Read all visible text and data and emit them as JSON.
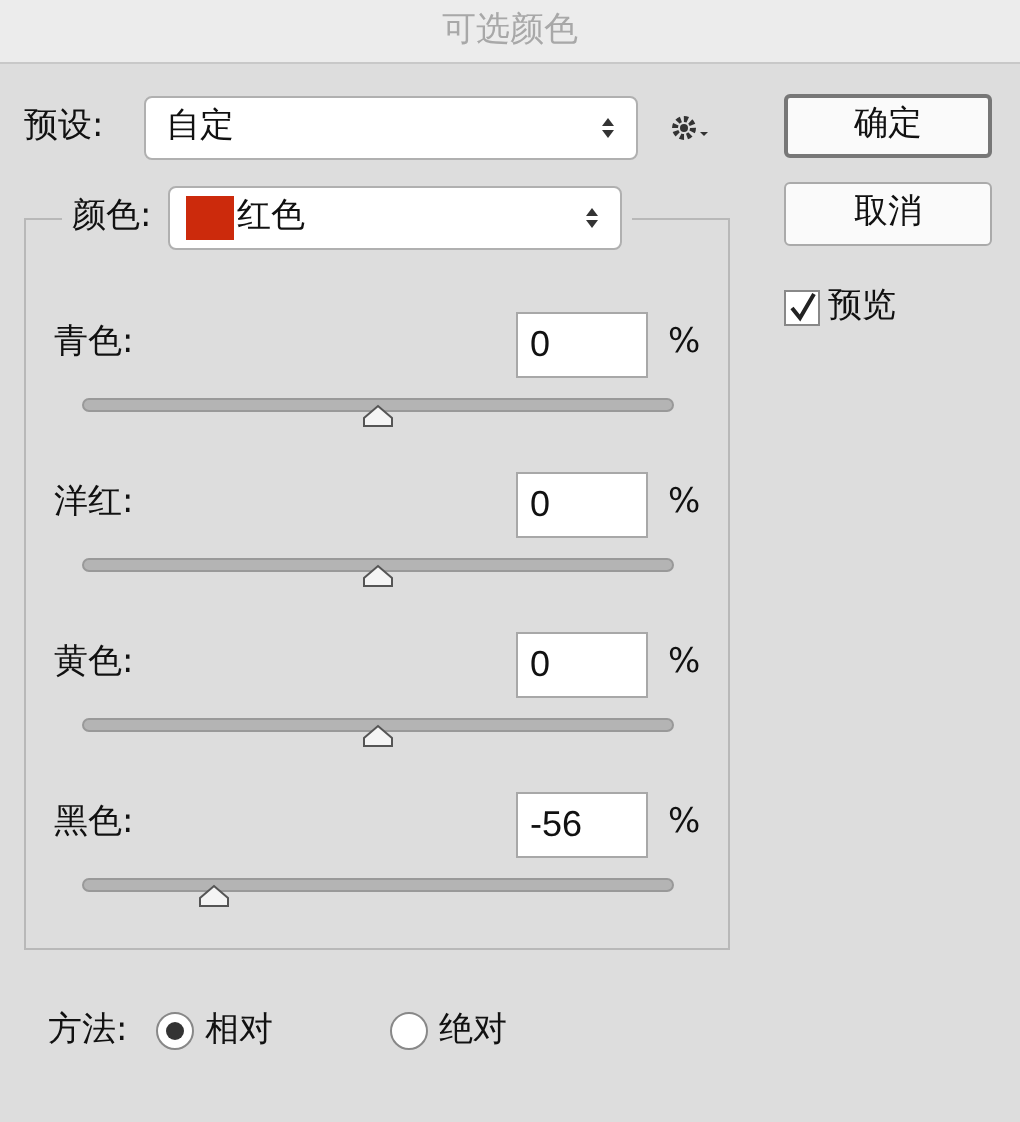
{
  "window": {
    "title": "可选颜色"
  },
  "preset": {
    "label": "预设:",
    "value": "自定"
  },
  "color": {
    "label": "颜色:",
    "value": "红色",
    "color": "#cc2a0c"
  },
  "channels": [
    {
      "name": "青色:",
      "value": "0",
      "unit": "%",
      "level": 0.5
    },
    {
      "name": "洋红:",
      "value": "0",
      "unit": "%",
      "level": 0.5
    },
    {
      "name": "黄色:",
      "value": "0",
      "unit": "%",
      "level": 0.5
    },
    {
      "name": "黑色:",
      "value": "-56",
      "unit": "%",
      "level": 0.22
    }
  ],
  "buttons": [
    "确定",
    "取消"
  ],
  "preview": {
    "label": "预览",
    "checked": true
  },
  "method": {
    "label": "方法:",
    "options": [
      {
        "label": "相对",
        "selected": true
      },
      {
        "label": "绝对",
        "selected": false
      }
    ]
  }
}
